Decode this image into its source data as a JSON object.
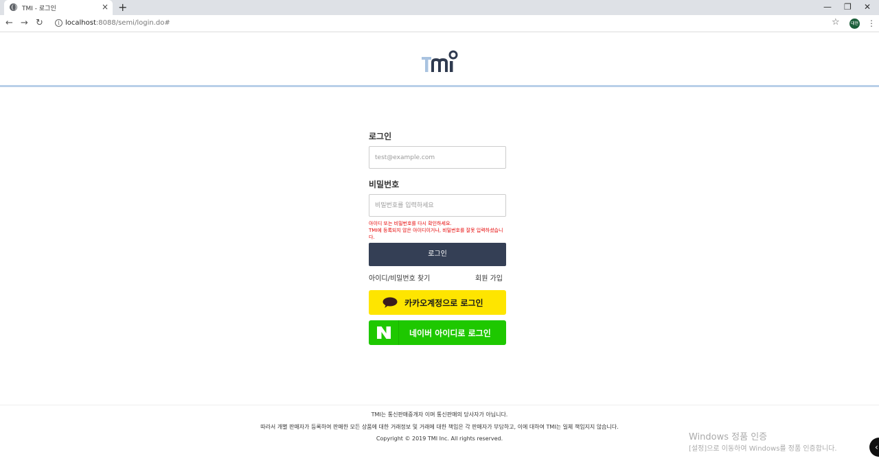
{
  "browser": {
    "tab_title": "TMI - 로그인",
    "tab_close": "×",
    "new_tab": "+",
    "url_host": "localhost",
    "url_path": ":8088/semi/login.do#",
    "profile_label": "대현",
    "win_minimize": "—",
    "win_restore": "❐",
    "win_close": "✕"
  },
  "header": {
    "logo_text": "TMI"
  },
  "login": {
    "id_label": "로그인",
    "id_placeholder": "test@example.com",
    "pw_label": "비밀번호",
    "pw_placeholder": "비밀번호를 입력하세요",
    "error_line1": "아이디 또는 비밀번호를 다시 확인하세요.",
    "error_line2": "TMI에 등록되지 않은 아이디이거나, 비밀번호를 잘못 입력하셨습니다.",
    "submit_label": "로그인",
    "find_link": "아이디/비밀번호 찾기",
    "join_link": "회원 가입",
    "kakao_label": "카카오계정으로 로그인",
    "naver_label": "네이버 아이디로 로그인"
  },
  "footer": {
    "line1": "TMI는 통신판매중개자 이며 통신판매의 당사자가 아닙니다.",
    "line2": "따라서 개별 판매자가 등록하여 판매한 모든 상품에 대한 거래정보 및 거래에 대한 책임은 각 판매자가 부담하고, 이에 대하여 TMI는 일체 책임지지 않습니다.",
    "copyright": "Copyright © 2019 TMI Inc. All rights reserved."
  },
  "watermark": {
    "line1": "Windows 정품 인증",
    "line2": "[설정]으로 이동하여 Windows를 정품 인증합니다."
  },
  "colors": {
    "login_button": "#343f55",
    "kakao": "#fee500",
    "naver": "#1ec800",
    "error": "#e60000",
    "header_rule": "#b8cfe8"
  },
  "icons": {
    "kakao": "speech-bubble-icon",
    "naver": "naver-n-icon"
  }
}
